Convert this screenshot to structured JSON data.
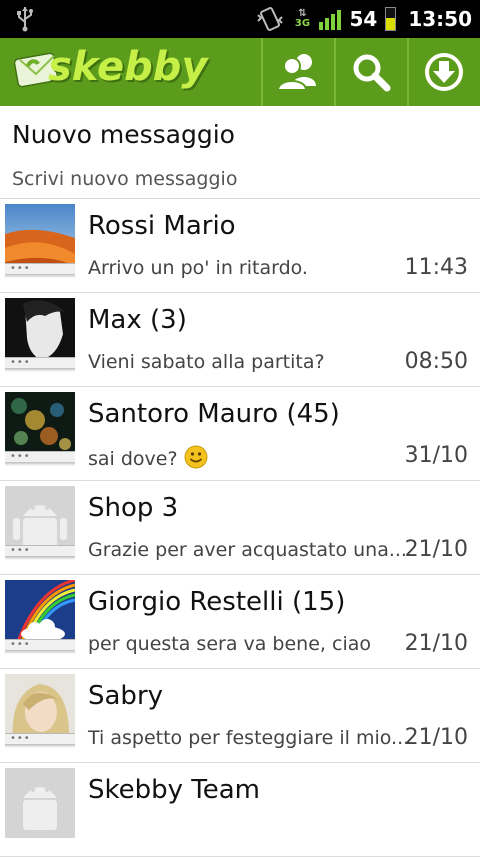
{
  "status_bar": {
    "network": "3G",
    "battery": "54",
    "time": "13:50"
  },
  "app": {
    "brand": "skebby",
    "actions": [
      "contacts",
      "search",
      "download"
    ]
  },
  "new_message": {
    "title": "Nuovo messaggio",
    "subtitle": "Scrivi nuovo messaggio"
  },
  "conversations": [
    {
      "name": "Rossi Mario",
      "snippet": "Arrivo un po' in ritardo.",
      "time": "11:43",
      "avatar": "desert-photo"
    },
    {
      "name": "Max (3)",
      "snippet": "Vieni sabato alla partita?",
      "time": "08:50",
      "avatar": "man-portrait-photo"
    },
    {
      "name": "Santoro Mauro (45)",
      "snippet": "sai dove?",
      "time": "31/10",
      "avatar": "bokeh-lights-photo"
    },
    {
      "name": "Shop 3",
      "snippet": "Grazie per aver acquastato una...",
      "time": "21/10",
      "avatar": "default-android-avatar"
    },
    {
      "name": "Giorgio Restelli (15)",
      "snippet": "per questa sera va bene, ciao",
      "time": "21/10",
      "avatar": "rainbow-photo"
    },
    {
      "name": "Sabry",
      "snippet": "Ti aspetto per festeggiare il mio...",
      "time": "21/10",
      "avatar": "woman-portrait-photo"
    },
    {
      "name": "Skebby Team",
      "snippet": "",
      "time": "",
      "avatar": "default-android-avatar"
    }
  ],
  "colors": {
    "action_bar": "#5c9c1c",
    "status_bar": "#000000"
  }
}
